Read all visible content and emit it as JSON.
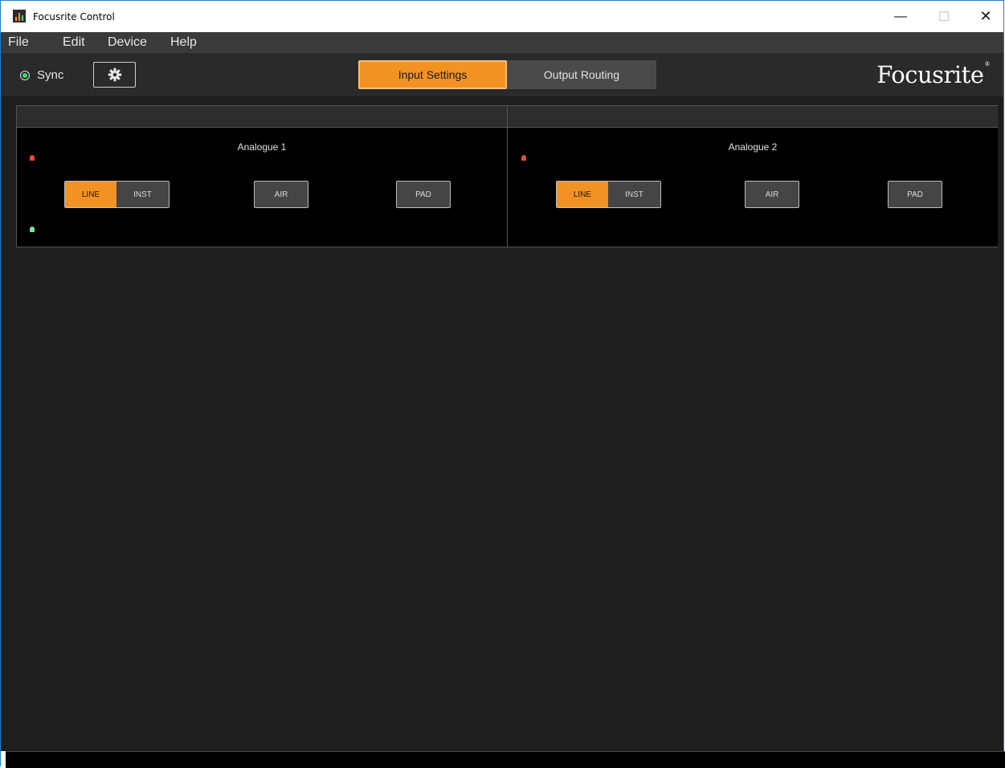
{
  "window": {
    "title": "Focusrite Control",
    "controls": {
      "minimize": "—",
      "maximize": "☐",
      "close": "✕"
    }
  },
  "menu": [
    "File",
    "Edit",
    "Device",
    "Help"
  ],
  "toolbar": {
    "sync_label": "Sync",
    "settings_icon": "gear-icon",
    "tabs": [
      {
        "label": "Input Settings",
        "active": true
      },
      {
        "label": "Output Routing",
        "active": false
      }
    ],
    "logo": "Focusrite",
    "logo_mark": "®"
  },
  "channels": [
    {
      "name": "Analogue 1",
      "line_label": "LINE",
      "inst_label": "INST",
      "air_label": "AIR",
      "pad_label": "PAD",
      "line_active": true
    },
    {
      "name": "Analogue 2",
      "line_label": "LINE",
      "inst_label": "INST",
      "air_label": "AIR",
      "pad_label": "PAD",
      "line_active": true
    }
  ],
  "colors": {
    "accent": "#f29222",
    "sync_ok": "#2ee06b",
    "clip_led": "#e04a3a",
    "signal_led": "#7fe0a0"
  }
}
